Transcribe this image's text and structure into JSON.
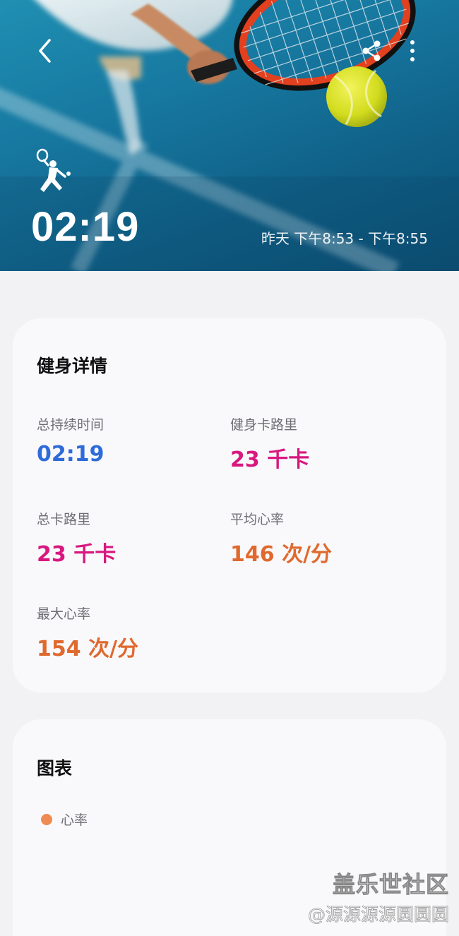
{
  "header": {
    "duration": "02:19",
    "time_range": "昨天 下午8:53 - 下午8:55",
    "icons": {
      "back": "back-chevron-icon",
      "share": "share-icon",
      "more": "more-vertical-icon",
      "sport": "tennis-player-icon"
    }
  },
  "details": {
    "title": "健身详情",
    "metrics": [
      {
        "label": "总持续时间",
        "value": "02:19",
        "color": "#2f6bd8"
      },
      {
        "label": "健身卡路里",
        "value": "23 千卡",
        "color": "#d8187f"
      },
      {
        "label": "总卡路里",
        "value": "23 千卡",
        "color": "#d8187f"
      },
      {
        "label": "平均心率",
        "value": "146 次/分",
        "color": "#e0692e"
      },
      {
        "label": "最大心率",
        "value": "154 次/分",
        "color": "#e0692e"
      }
    ]
  },
  "chart": {
    "title": "图表",
    "legend": "心率",
    "legend_color": "#ef8a52"
  },
  "watermark": {
    "title": "盖乐世社区",
    "subtitle": "@源源源源圆圆圆"
  }
}
